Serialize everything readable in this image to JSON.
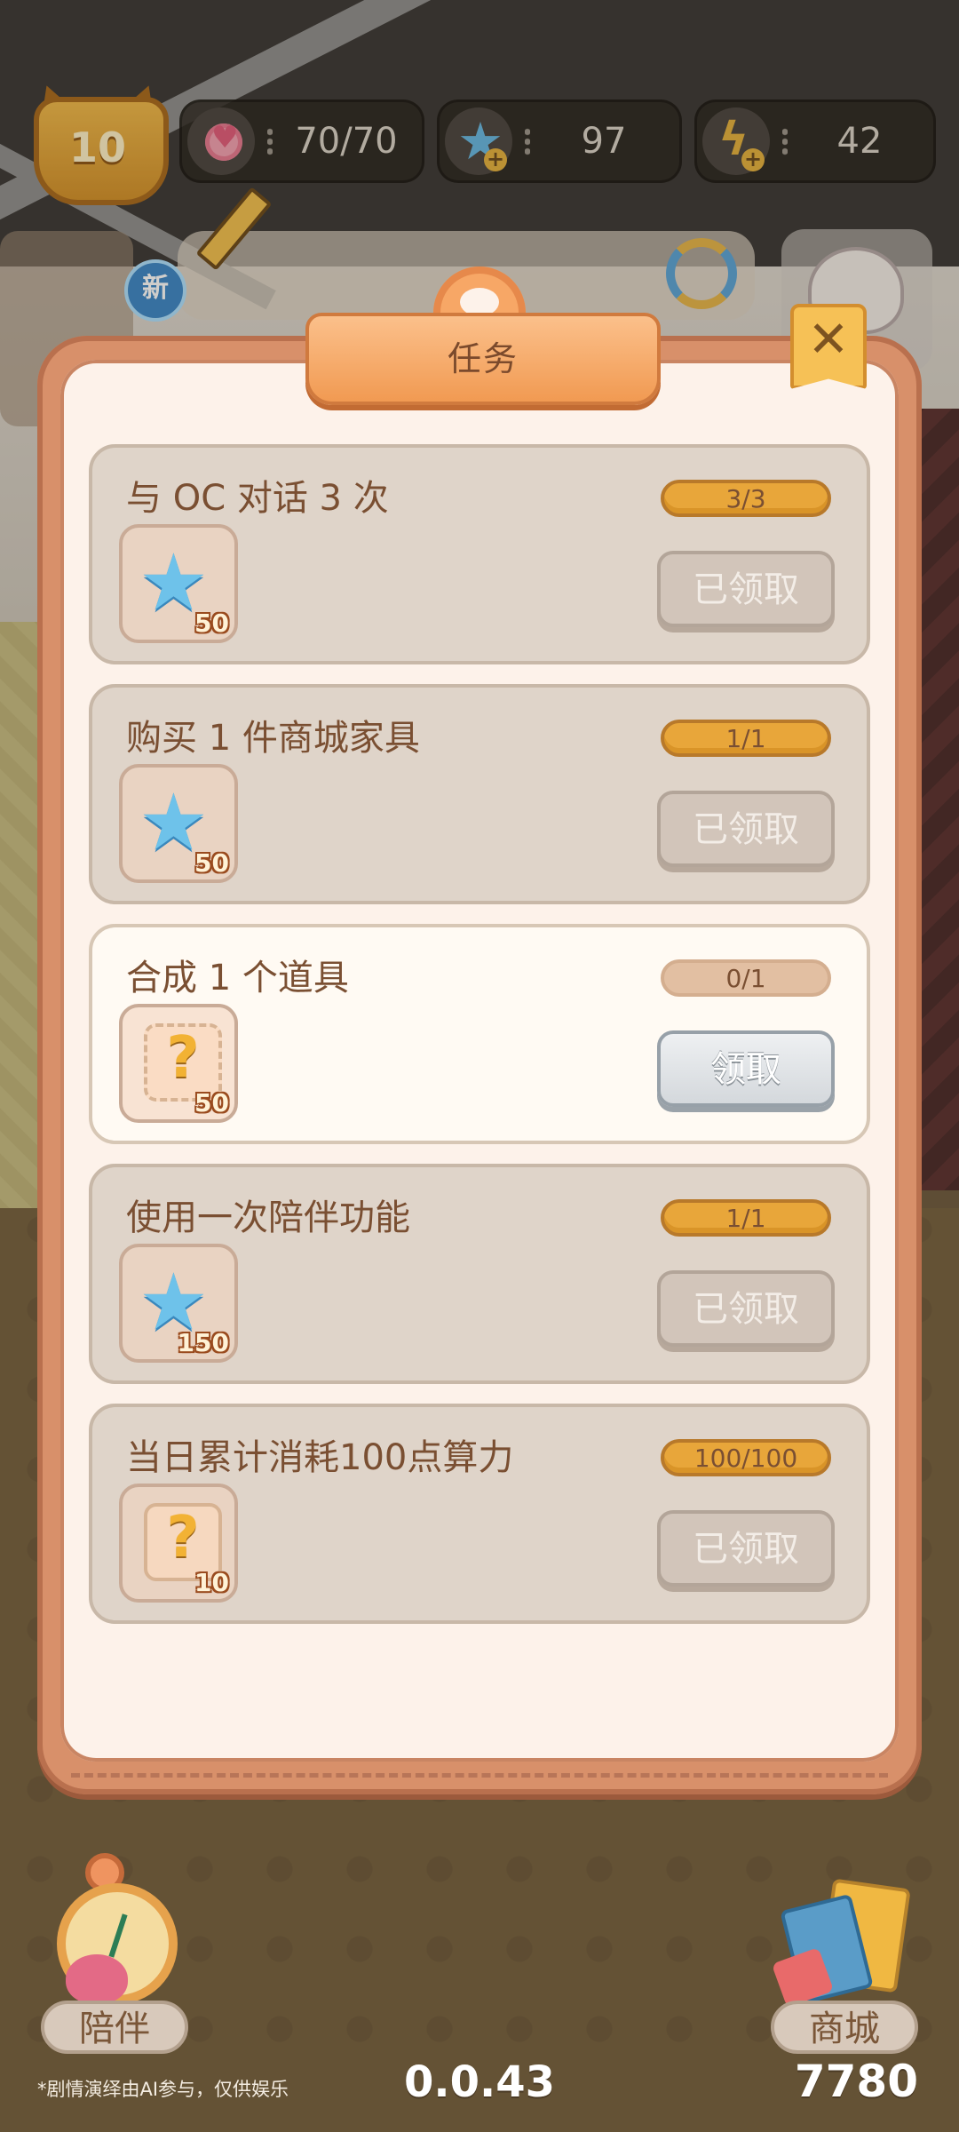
{
  "hud": {
    "level": "10",
    "hearts": "70/70",
    "stars": "97",
    "energy": "42",
    "new_badge": "新"
  },
  "modal": {
    "title": "任务",
    "close_label": "✕",
    "tasks": [
      {
        "title": "与 OC 对话 3 次",
        "progress": "3/3",
        "reward_icon": "star-icon",
        "reward_count": "50",
        "button": "已领取"
      },
      {
        "title": "购买 1 件商城家具",
        "progress": "1/1",
        "reward_icon": "star-icon",
        "reward_count": "50",
        "button": "已领取"
      },
      {
        "title": "合成 1 个道具",
        "progress": "0/1",
        "reward_icon": "mystery-puzzle-icon",
        "reward_count": "50",
        "button": "领取"
      },
      {
        "title": "使用一次陪伴功能",
        "progress": "1/1",
        "reward_icon": "star-icon",
        "reward_count": "150",
        "button": "已领取"
      },
      {
        "title": "当日累计消耗100点算力",
        "progress": "100/100",
        "reward_icon": "mystery-sofa-icon",
        "reward_count": "10",
        "button": "已领取"
      }
    ]
  },
  "bottom": {
    "companion_label": "陪伴",
    "shop_label": "商城",
    "footnote": "*剧情演绎由AI参与，仅供娱乐",
    "version": "0.0.43",
    "score": "7780"
  },
  "colors": {
    "frame": "#d8906a",
    "panel": "#fdf2ea",
    "progress_full": "#e8a63a",
    "card_done": "#dfd4c9",
    "card_active": "#fffaf3"
  }
}
